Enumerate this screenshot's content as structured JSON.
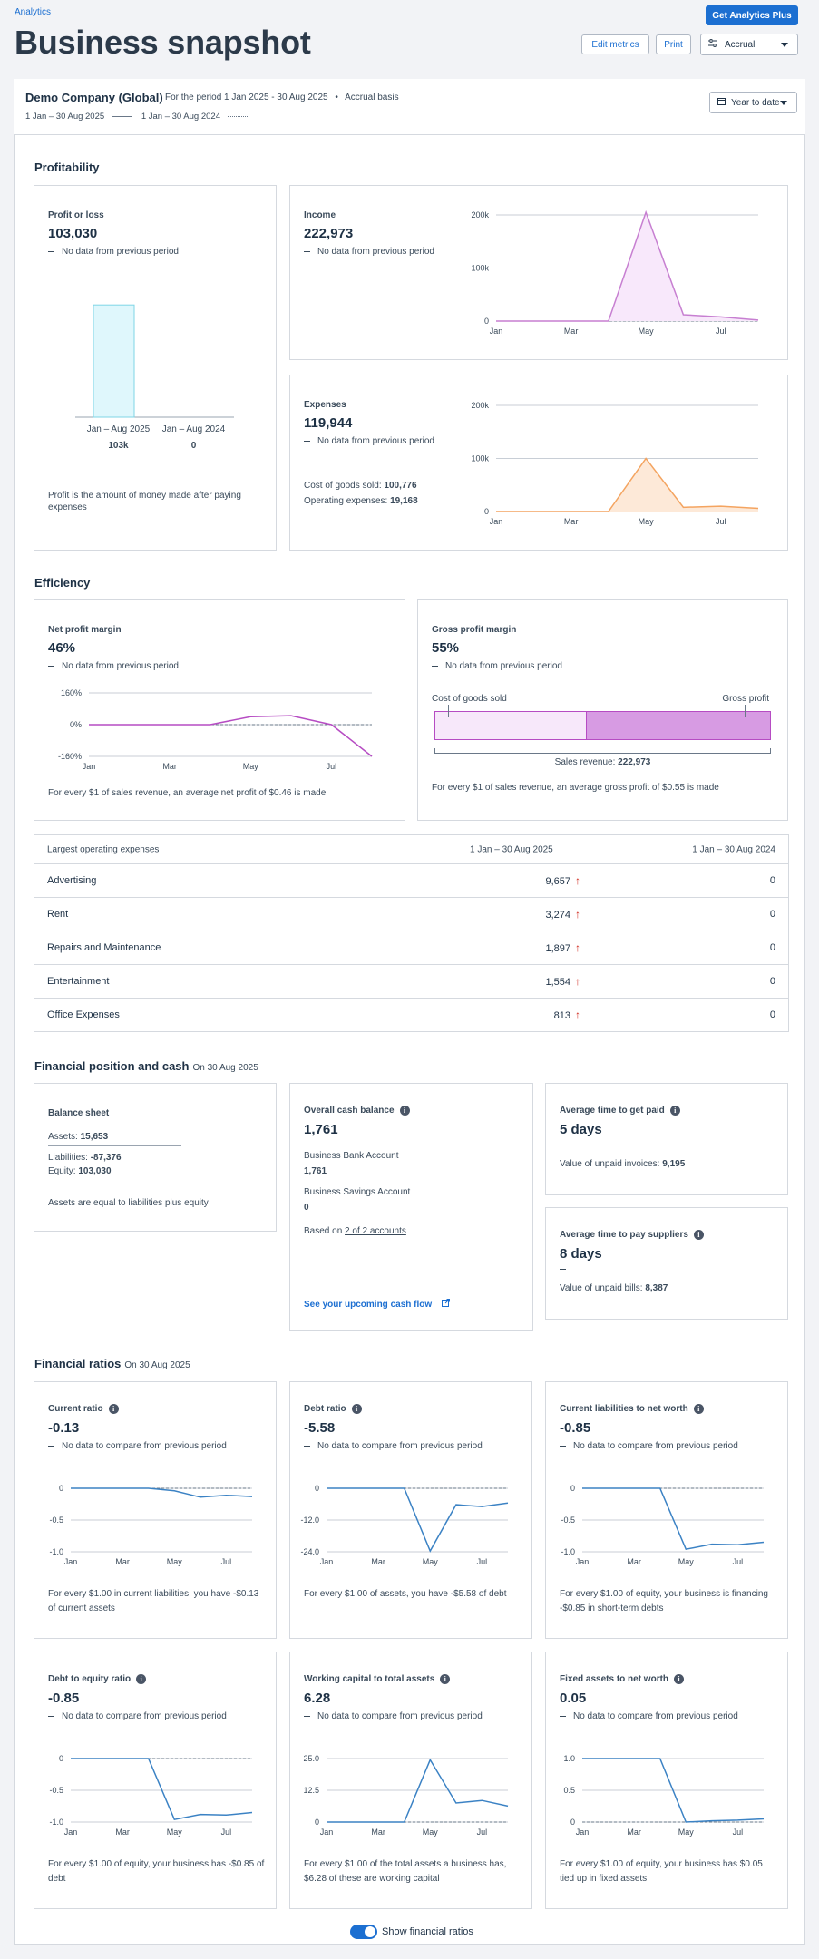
{
  "header": {
    "breadcrumb": "Analytics",
    "title": "Business snapshot",
    "get_plus": "Get Analytics Plus",
    "edit_metrics": "Edit metrics",
    "print": "Print",
    "basis_select": "Accrual"
  },
  "company": {
    "name": "Demo Company (Global)",
    "period_text": "For the period 1 Jan 2025 - 30 Aug 2025",
    "basis_text": "Accrual basis",
    "legend_current": "1 Jan – 30 Aug 2025",
    "legend_previous": "1 Jan – 30 Aug 2024",
    "range_select": "Year to date"
  },
  "profitability": {
    "heading": "Profitability",
    "profit": {
      "label": "Profit or loss",
      "value": "103,030",
      "nodata": "No data from previous period",
      "bar_current_label": "Jan – Aug 2025",
      "bar_previous_label": "Jan – Aug 2024",
      "bar_current_value": "103k",
      "bar_previous_value": "0",
      "footnote": "Profit is the amount of money made after paying expenses"
    },
    "income": {
      "label": "Income",
      "value": "222,973",
      "nodata": "No data from previous period"
    },
    "expenses": {
      "label": "Expenses",
      "value": "119,944",
      "nodata": "No data from previous period",
      "cogs_label": "Cost of goods sold:",
      "cogs_value": "100,776",
      "opex_label": "Operating expenses:",
      "opex_value": "19,168"
    }
  },
  "efficiency": {
    "heading": "Efficiency",
    "net_margin": {
      "label": "Net profit margin",
      "value": "46%",
      "nodata": "No data from previous period",
      "footnote": "For every $1 of sales revenue, an average net profit of $0.46 is made"
    },
    "gross_margin": {
      "label": "Gross profit margin",
      "value": "55%",
      "nodata": "No data from previous period",
      "cogs_label": "Cost of goods sold",
      "gross_label": "Gross profit",
      "revenue_label": "Sales revenue:",
      "revenue_value": "222,973",
      "gross_fraction": 0.55,
      "footnote": "For every $1 of sales revenue, an average gross profit of $0.55 is made"
    }
  },
  "expenses_table": {
    "col_name": "Largest operating expenses",
    "col_current": "1 Jan – 30 Aug 2025",
    "col_previous": "1 Jan – 30 Aug 2024",
    "rows": [
      {
        "name": "Advertising",
        "current": "9,657",
        "previous": "0"
      },
      {
        "name": "Rent",
        "current": "3,274",
        "previous": "0"
      },
      {
        "name": "Repairs and Maintenance",
        "current": "1,897",
        "previous": "0"
      },
      {
        "name": "Entertainment",
        "current": "1,554",
        "previous": "0"
      },
      {
        "name": "Office Expenses",
        "current": "813",
        "previous": "0"
      }
    ]
  },
  "position": {
    "heading": "Financial position and cash",
    "date": "On 30 Aug 2025",
    "balance": {
      "label": "Balance sheet",
      "assets_label": "Assets:",
      "assets_value": "15,653",
      "liab_label": "Liabilities:",
      "liab_value": "-87,376",
      "equity_label": "Equity:",
      "equity_value": "103,030",
      "footnote": "Assets are equal to liabilities plus equity"
    },
    "cash": {
      "label": "Overall cash balance",
      "value": "1,761",
      "acct1_name": "Business Bank Account",
      "acct1_value": "1,761",
      "acct2_name": "Business Savings Account",
      "acct2_value": "0",
      "based_on": "Based on",
      "based_link": "2 of 2 accounts",
      "cashflow_link": "See your upcoming cash flow"
    },
    "get_paid": {
      "label": "Average time to get paid",
      "value": "5 days",
      "sub_label": "Value of unpaid invoices:",
      "sub_value": "9,195"
    },
    "pay_suppliers": {
      "label": "Average time to pay suppliers",
      "value": "8 days",
      "sub_label": "Value of unpaid bills:",
      "sub_value": "8,387"
    }
  },
  "ratios": {
    "heading": "Financial ratios",
    "date": "On 30 Aug 2025",
    "nodata": "No data to compare from previous period",
    "items": [
      {
        "label": "Current ratio",
        "value": "-0.13",
        "footnote": "For every $1.00 in current liabilities, you have -$0.13 of current assets"
      },
      {
        "label": "Debt ratio",
        "value": "-5.58",
        "footnote": "For every $1.00 of assets, you have -$5.58 of debt"
      },
      {
        "label": "Current liabilities to net worth",
        "value": "-0.85",
        "footnote": "For every $1.00 of equity, your business is financing -$0.85 in short-term debts"
      },
      {
        "label": "Debt to equity ratio",
        "value": "-0.85",
        "footnote": "For every $1.00 of equity, your business has -$0.85 of debt"
      },
      {
        "label": "Working capital to total assets",
        "value": "6.28",
        "footnote": "For every $1.00 of the total assets a business has, $6.28 of these are working capital"
      },
      {
        "label": "Fixed assets to net worth",
        "value": "0.05",
        "footnote": "For every $1.00 of equity, your business has $0.05 tied up in fixed assets"
      }
    ]
  },
  "footer": {
    "toggle_label": "Show financial ratios"
  },
  "chart_data": [
    {
      "type": "bar",
      "name": "profit_or_loss",
      "categories": [
        "Jan – Aug 2025",
        "Jan – Aug 2024"
      ],
      "values": [
        103030,
        0
      ],
      "color": "#dff7fc"
    },
    {
      "type": "area",
      "name": "income",
      "x": [
        "Jan",
        "Feb",
        "Mar",
        "Apr",
        "May",
        "Jun",
        "Jul",
        "Aug"
      ],
      "values": [
        0,
        0,
        0,
        0,
        205000,
        12000,
        8000,
        2000
      ],
      "ylim": [
        0,
        200000
      ],
      "yticks": [
        "200k",
        "100k",
        "0"
      ],
      "xticks": [
        "Jan",
        "Mar",
        "May",
        "Jul"
      ],
      "color": "#c77fd1"
    },
    {
      "type": "area",
      "name": "expenses",
      "x": [
        "Jan",
        "Feb",
        "Mar",
        "Apr",
        "May",
        "Jun",
        "Jul",
        "Aug"
      ],
      "values": [
        0,
        0,
        0,
        0,
        100000,
        8000,
        10000,
        6000
      ],
      "ylim": [
        0,
        200000
      ],
      "yticks": [
        "200k",
        "100k",
        "0"
      ],
      "xticks": [
        "Jan",
        "Mar",
        "May",
        "Jul"
      ],
      "color": "#f4a460"
    },
    {
      "type": "line",
      "name": "net_profit_margin",
      "x": [
        "Jan",
        "Feb",
        "Mar",
        "Apr",
        "May",
        "Jun",
        "Jul",
        "Aug"
      ],
      "values": [
        0,
        0,
        0,
        0,
        40,
        45,
        0,
        -160
      ],
      "ylim": [
        -160,
        160
      ],
      "yticks": [
        "160%",
        "0%",
        "-160%"
      ],
      "xticks": [
        "Jan",
        "Mar",
        "May",
        "Jul"
      ],
      "color": "#b64cc3"
    },
    {
      "type": "line",
      "name": "current_ratio",
      "x": [
        "Jan",
        "Feb",
        "Mar",
        "Apr",
        "May",
        "Jun",
        "Jul",
        "Aug"
      ],
      "values": [
        0,
        0,
        0,
        0,
        -0.04,
        -0.14,
        -0.11,
        -0.13
      ],
      "ylim": [
        -1,
        0
      ],
      "yticks": [
        "0",
        "-0.5",
        "-1.0"
      ],
      "xticks": [
        "Jan",
        "Mar",
        "May",
        "Jul"
      ],
      "color": "#3b82c4"
    },
    {
      "type": "line",
      "name": "debt_ratio",
      "x": [
        "Jan",
        "Feb",
        "Mar",
        "Apr",
        "May",
        "Jun",
        "Jul",
        "Aug"
      ],
      "values": [
        0,
        0,
        0,
        0,
        -23.7,
        -6.2,
        -6.9,
        -5.58
      ],
      "ylim": [
        -24,
        0
      ],
      "yticks": [
        "0",
        "-12.0",
        "-24.0"
      ],
      "xticks": [
        "Jan",
        "Mar",
        "May",
        "Jul"
      ],
      "color": "#3b82c4"
    },
    {
      "type": "line",
      "name": "current_liabilities_to_net_worth",
      "x": [
        "Jan",
        "Feb",
        "Mar",
        "Apr",
        "May",
        "Jun",
        "Jul",
        "Aug"
      ],
      "values": [
        0,
        0,
        0,
        0,
        -0.96,
        -0.88,
        -0.89,
        -0.85
      ],
      "ylim": [
        -1,
        0
      ],
      "yticks": [
        "0",
        "-0.5",
        "-1.0"
      ],
      "xticks": [
        "Jan",
        "Mar",
        "May",
        "Jul"
      ],
      "color": "#3b82c4"
    },
    {
      "type": "line",
      "name": "debt_to_equity_ratio",
      "x": [
        "Jan",
        "Feb",
        "Mar",
        "Apr",
        "May",
        "Jun",
        "Jul",
        "Aug"
      ],
      "values": [
        0,
        0,
        0,
        0,
        -0.96,
        -0.88,
        -0.89,
        -0.85
      ],
      "ylim": [
        -1,
        0
      ],
      "yticks": [
        "0",
        "-0.5",
        "-1.0"
      ],
      "xticks": [
        "Jan",
        "Mar",
        "May",
        "Jul"
      ],
      "color": "#3b82c4"
    },
    {
      "type": "line",
      "name": "working_capital_to_total_assets",
      "x": [
        "Jan",
        "Feb",
        "Mar",
        "Apr",
        "May",
        "Jun",
        "Jul",
        "Aug"
      ],
      "values": [
        0,
        0,
        0,
        0,
        24.5,
        7.5,
        8.5,
        6.28
      ],
      "ylim": [
        0,
        25
      ],
      "yticks": [
        "25.0",
        "12.5",
        "0"
      ],
      "xticks": [
        "Jan",
        "Mar",
        "May",
        "Jul"
      ],
      "color": "#3b82c4"
    },
    {
      "type": "line",
      "name": "fixed_assets_to_net_worth",
      "x": [
        "Jan",
        "Feb",
        "Mar",
        "Apr",
        "May",
        "Jun",
        "Jul",
        "Aug"
      ],
      "values": [
        1,
        1,
        1,
        1,
        0,
        0.02,
        0.03,
        0.05
      ],
      "ylim": [
        0,
        1
      ],
      "yticks": [
        "1.0",
        "0.5",
        "0"
      ],
      "xticks": [
        "Jan",
        "Mar",
        "May",
        "Jul"
      ],
      "color": "#3b82c4"
    }
  ]
}
